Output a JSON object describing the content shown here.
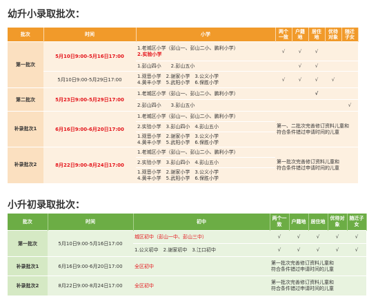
{
  "kindergarten": {
    "title": "幼升小录取批次：",
    "headers": [
      "批次",
      "时间",
      "小学",
      "两个一致",
      "户籍地",
      "居住地",
      "优待对象",
      "随迁子女"
    ],
    "rows": {
      "r1": {
        "batch": "第一批次",
        "date1": "5月10日9:00-5月16日17:00",
        "school1a": "1.老城区小学（彭山一、彭山二小、鹏利小学）",
        "school1b": "2.实验小学",
        "c1": [
          "√",
          "√",
          "√",
          "",
          ""
        ],
        "school2": "1.彭山四小　　2.彭山五小",
        "c2": [
          "",
          "√",
          "√",
          "",
          ""
        ],
        "date3": "5月10日9:00-5月29日17:00",
        "school3a": "1.观音小学　2.谢家小学　3.公义小学",
        "school3b": "4.黄丰小学　5.武阳小学　6.保胜小学",
        "c3": [
          "√",
          "√",
          "√",
          "√",
          ""
        ]
      },
      "r2": {
        "batch": "第二批次",
        "date": "5月23日9:00-5月29日17:00",
        "school1": "1.老城区小学（彭山一、彭山二小、鹏利小学）",
        "school2": "2.彭山四小　　3.彭山五小",
        "c1": [
          "",
          "",
          "√",
          "",
          ""
        ],
        "c2": [
          "",
          "",
          "",
          "",
          "√"
        ]
      },
      "r3": {
        "batch": "补录批次1",
        "date": "6月16日9:00-6月20日17:00",
        "school1": "1.老城区小学（彭山一、彭山二小、鹏利小学）",
        "school2": "2.实验小学　3.彭山四小　4.彭山五小",
        "school3a": "1.观音小学　2.谢家小学　3.公义小学",
        "school3b": "4.黄丰小学　5.武阳小学　6.保胜小学",
        "note_a": "第一、二批次完善修订资料儿童和",
        "note_b": "符合条件错过申请时间的儿童"
      },
      "r4": {
        "batch": "补录批次2",
        "date": "8月22日9:00-8月24日17:00",
        "school1": "1.老城区小学（彭山一、彭山二小、鹏利小学）",
        "school2": "2.实验小学　3.彭山四小　4.彭山五小",
        "school3a": "1.观音小学　2.谢家小学　3.公义小学",
        "school3b": "4.黄丰小学　5.武阳小学　6.保胜小学",
        "note_a": "第一批次完善修订资料儿童和",
        "note_b": "符合条件错过申请时间的儿童"
      }
    }
  },
  "primary": {
    "title": "小升初录取批次：",
    "headers": [
      "批次",
      "时间",
      "初中",
      "两个一致",
      "户籍地",
      "居住地",
      "优待对象",
      "随迁子女"
    ],
    "rows": {
      "r1": {
        "batch": "第一批次",
        "date": "5月10日9:00-5月16日17:00",
        "school1": "城区初中（彭山一中、彭山三中）",
        "c1": [
          "√",
          "√",
          "√",
          "√",
          "√"
        ],
        "school2": "1.公义初中　2.谢家初中　3.江口初中",
        "c2": [
          "√",
          "√",
          "√",
          "√",
          "√"
        ]
      },
      "r2": {
        "batch": "补录批次1",
        "date": "6月16日9:00-6月20日17:00",
        "school": "全区初中",
        "note_a": "第一批次完善修订资料儿童和",
        "note_b": "符合条件错过申请时间的儿童"
      },
      "r3": {
        "batch": "补录批次2",
        "date": "8月22日9:00-8月24日17:00",
        "school": "全区初中",
        "note_a": "第一批次完善修订资料儿童和",
        "note_b": "符合条件错过申请时间的儿童"
      }
    }
  }
}
